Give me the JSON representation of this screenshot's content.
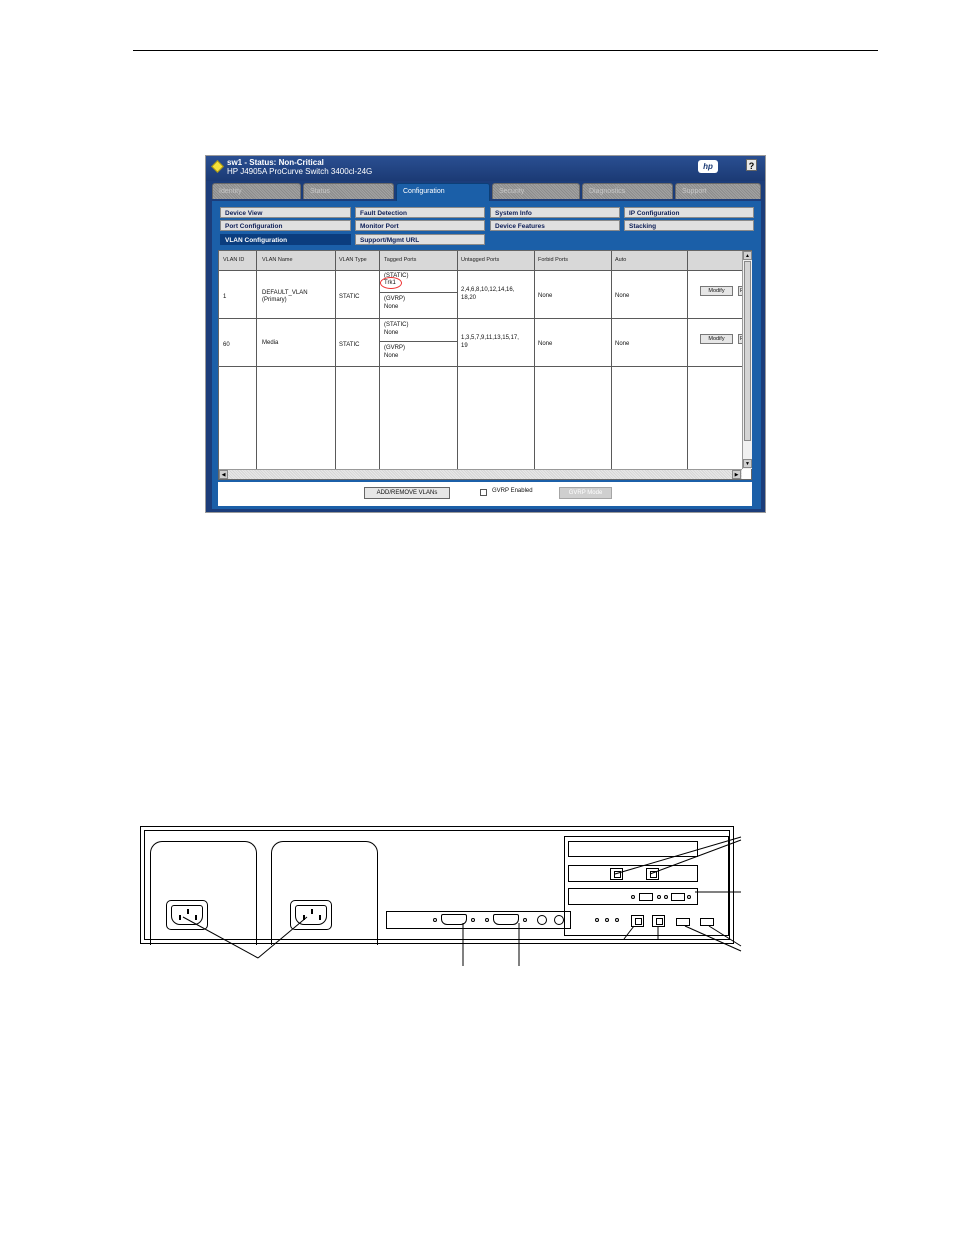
{
  "window": {
    "title": "sw1 - Status: Non-Critical",
    "subtitle": "HP J4905A ProCurve Switch 3400cl-24G",
    "logo": "hp",
    "help": "?"
  },
  "tabs": [
    "Identity",
    "Status",
    "Configuration",
    "Security",
    "Diagnostics",
    "Support"
  ],
  "subnav": [
    "Device View",
    "Fault Detection",
    "System Info",
    "IP Configuration",
    "Port Configuration",
    "Monitor Port",
    "Device Features",
    "Stacking",
    "VLAN Configuration",
    "Support/Mgmt URL"
  ],
  "table": {
    "columns": [
      "VLAN ID",
      "VLAN Name",
      "VLAN Type",
      "Tagged Ports",
      "Untagged Ports",
      "Forbid Ports",
      "Auto"
    ],
    "rows": [
      {
        "id": "1",
        "name": "DEFAULT_VLAN",
        "name2": "(Primary)",
        "type": "STATIC",
        "tagged_static_label": "(STATIC)",
        "tagged_static": "Trk1",
        "tagged_gvrp_label": "(GVRP)",
        "tagged_gvrp": "None",
        "untagged": "2,4,6,8,10,12,14,16,",
        "untagged2": "18,20",
        "forbid": "None",
        "auto": "None",
        "action": "Modify",
        "action2": "R"
      },
      {
        "id": "60",
        "name": "Media",
        "name2": "",
        "type": "STATIC",
        "tagged_static_label": "(STATIC)",
        "tagged_static": "None",
        "tagged_gvrp_label": "(GVRP)",
        "tagged_gvrp": "None",
        "untagged": "1,3,5,7,9,11,13,15,17,",
        "untagged2": "19",
        "forbid": "None",
        "auto": "None",
        "action": "Modify",
        "action2": "R"
      }
    ]
  },
  "footer": {
    "add_remove": "ADD/REMOVE VLANs",
    "gvrp_enabled": "GVRP Enabled",
    "gvrp_mode": "GVRP Mode"
  }
}
